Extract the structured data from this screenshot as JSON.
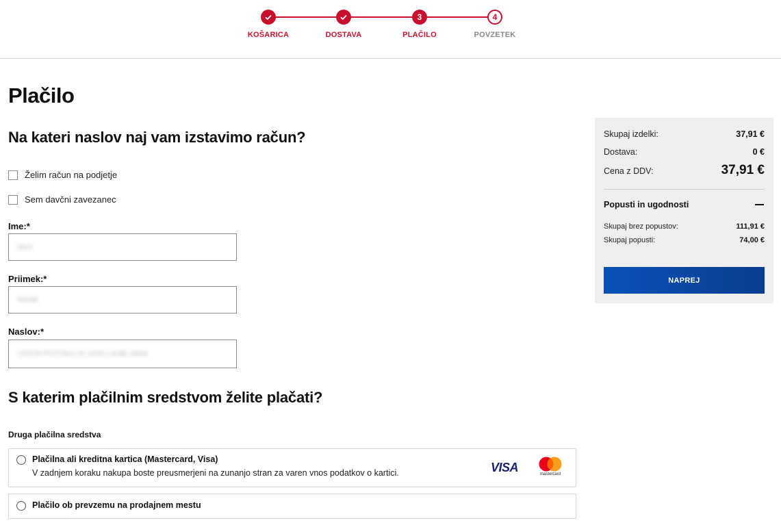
{
  "stepper": {
    "steps": [
      {
        "label": "KOŠARICA",
        "state": "done"
      },
      {
        "label": "DOSTAVA",
        "state": "done"
      },
      {
        "label": "PLAČILO",
        "number": "3",
        "state": "active"
      },
      {
        "label": "POVZETEK",
        "number": "4",
        "state": "pending"
      }
    ]
  },
  "page": {
    "title": "Plačilo"
  },
  "invoice": {
    "heading": "Na kateri naslov naj vam izstavimo račun?",
    "company_checkbox": "Želim račun na podjetje",
    "tax_checkbox": "Sem davčni zavezanec",
    "first_name_label": "Ime:*",
    "first_name_value": "Nina",
    "last_name_label": "Priimek:*",
    "last_name_value": "Novak",
    "address_label": "Naslov:*",
    "address_value": "CESTA POTOKU 15 1000 LJUBLJANA"
  },
  "payment": {
    "heading": "S katerim plačilnim sredstvom želite plačati?",
    "other_label": "Druga plačilna sredstva",
    "card_title": "Plačilna ali kreditna kartica (Mastercard, Visa)",
    "card_desc": "V zadnjem koraku nakupa boste preusmerjeni na zunanjo stran za varen vnos podatkov o kartici.",
    "visa_text": "VISA",
    "mastercard_text": "mastercard",
    "pickup_title": "Plačilo ob prevzemu na prodajnem mestu"
  },
  "summary": {
    "items_label": "Skupaj izdelki:",
    "items_value": "37,91 €",
    "shipping_label": "Dostava:",
    "shipping_value": "0 €",
    "total_label": "Cena z DDV:",
    "total_value": "37,91 €",
    "discounts_label": "Popusti in ugodnosti",
    "without_discount_label": "Skupaj brez popustov:",
    "without_discount_value": "111,91 €",
    "discount_total_label": "Skupaj popusti:",
    "discount_total_value": "74,00 €",
    "next_button": "NAPREJ"
  },
  "colors": {
    "accent": "#c8102e",
    "button": "#0a4aa8",
    "summary_bg": "#efefef"
  }
}
